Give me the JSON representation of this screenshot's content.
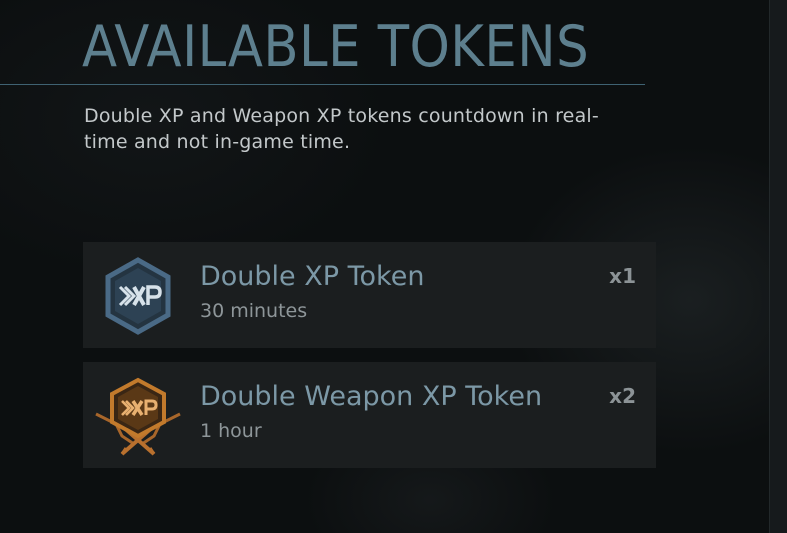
{
  "header": {
    "title": "AVAILABLE TOKENS",
    "description": "Double XP and Weapon XP tokens countdown in real-time and not in-game time."
  },
  "tokens": [
    {
      "name": "Double XP Token",
      "duration": "30 minutes",
      "count": "x1",
      "icon": "double-xp-icon",
      "icon_color": "#4a6a86"
    },
    {
      "name": "Double Weapon XP Token",
      "duration": "1 hour",
      "count": "x2",
      "icon": "double-weapon-xp-icon",
      "icon_color": "#c27a2c"
    }
  ],
  "colors": {
    "title": "#5d7f8e",
    "token_name": "#7c98a6",
    "card_background": "#1b1e1f",
    "page_background": "#0c0f10"
  }
}
